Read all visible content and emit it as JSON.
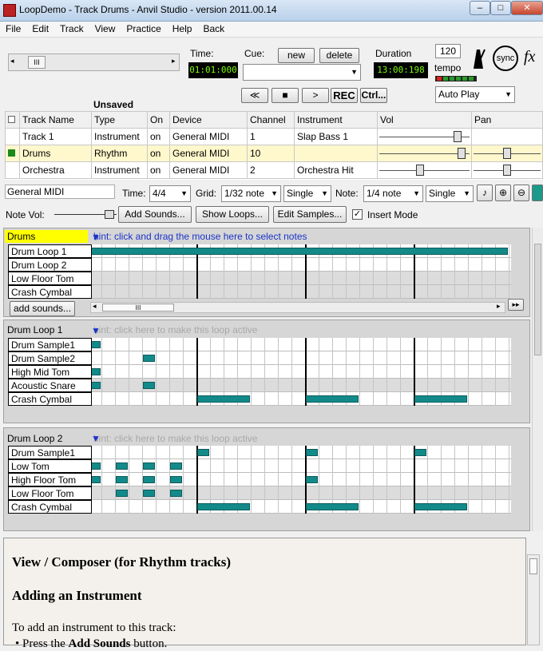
{
  "window": {
    "title": "LoopDemo - Track Drums - Anvil Studio - version 2011.00.14"
  },
  "menu": [
    "File",
    "Edit",
    "Track",
    "View",
    "Practice",
    "Help",
    "Back"
  ],
  "transport": {
    "time_label": "Time:",
    "time_value": "01:01:000",
    "cue_label": "Cue:",
    "new_label": "new",
    "delete_label": "delete",
    "duration_label": "Duration",
    "duration_value": "13:00:198",
    "tempo_value": "120",
    "tempo_label": "tempo",
    "rewind": "≪",
    "stop": "■",
    "play": ">",
    "rec": "REC",
    "ctrl": "Ctrl...",
    "autoplay": "Auto Play",
    "unsaved": "Unsaved",
    "sync": "sync",
    "fx": "fx"
  },
  "tracks": {
    "headers": [
      "Track Name",
      "Type",
      "On",
      "Device",
      "Channel",
      "Instrument",
      "Vol",
      "Pan"
    ],
    "rows": [
      {
        "name": "Track 1",
        "type": "Instrument",
        "on": "on",
        "device": "General MIDI",
        "channel": "1",
        "instrument": "Slap Bass 1",
        "vol": 0.9,
        "pan": null
      },
      {
        "name": "Drums",
        "type": "Rhythm",
        "on": "on",
        "device": "General MIDI",
        "channel": "10",
        "instrument": "",
        "vol": 0.95,
        "pan": 0.5
      },
      {
        "name": "Orchestra",
        "type": "Instrument",
        "on": "on",
        "device": "General MIDI",
        "channel": "2",
        "instrument": "Orchestra Hit",
        "vol": 0.45,
        "pan": 0.5
      }
    ]
  },
  "toolbar2": {
    "device": "General MIDI",
    "time_label": "Time:",
    "time_sig": "4/4",
    "grid_label": "Grid:",
    "grid_value": "1/32 note",
    "grid_mode": "Single",
    "note_label": "Note:",
    "note_value": "1/4 note",
    "note_mode": "Single"
  },
  "toolbar3": {
    "notevol_label": "Note Vol:",
    "add_sounds": "Add Sounds...",
    "show_loops": "Show Loops...",
    "edit_samples": "Edit Samples...",
    "insert_mode": "Insert Mode"
  },
  "panel1": {
    "title": "Drums",
    "hint": "hint:  click and drag the mouse here to select notes",
    "rows": [
      "Drum Loop 1",
      "Drum Loop 2",
      "Low Floor Tom",
      "Crash Cymbal"
    ],
    "add_sounds": "add sounds...",
    "scroll_thumb": "III"
  },
  "panel2": {
    "title": "Drum Loop 1",
    "hint": "hint:  click here to make this loop active",
    "rows": [
      "Drum Sample1",
      "Drum Sample2",
      "High Mid Tom",
      "Acoustic Snare",
      "Crash Cymbal"
    ]
  },
  "panel3": {
    "title": "Drum Loop 2",
    "hint": "hint:  click here to make this loop active",
    "rows": [
      "Drum Sample1",
      "Low Tom",
      "High Floor Tom",
      "Low Floor Tom",
      "Crash Cymbal"
    ]
  },
  "help": {
    "heading1": "View / Composer (for Rhythm tracks)",
    "heading2": "Adding an Instrument",
    "para": "To add an instrument to this track:",
    "bullet_pre": "Press the ",
    "bullet_bold": "Add Sounds",
    "bullet_post": " button."
  },
  "colors": {
    "note": "#138a8a",
    "accent_drums": "#ffff00",
    "lcd_text": "#7cfc00"
  }
}
